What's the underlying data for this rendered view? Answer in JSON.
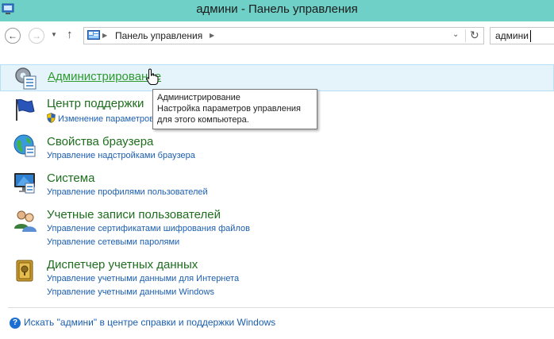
{
  "window": {
    "title": "админи - Панель управления"
  },
  "address": {
    "crumb": "Панель управления",
    "search_value": "админи"
  },
  "results": [
    {
      "heading": "Администрирование",
      "icon": "admin-tools-icon",
      "links": []
    },
    {
      "heading": "Центр поддержки",
      "icon": "flag-icon",
      "links": [
        "Изменение параметров"
      ]
    },
    {
      "heading": "Свойства браузера",
      "icon": "globe-icon",
      "links": [
        "Управление надстройками браузера"
      ]
    },
    {
      "heading": "Система",
      "icon": "computer-icon",
      "links": [
        "Управление профилями пользователей"
      ]
    },
    {
      "heading": "Учетные записи пользователей",
      "icon": "users-icon",
      "links": [
        "Управление сертификатами шифрования файлов",
        "Управление сетевыми паролями"
      ]
    },
    {
      "heading": "Диспетчер учетных данных",
      "icon": "vault-icon",
      "links": [
        "Управление учетными данными для Интернета",
        "Управление учетными данными Windows"
      ]
    }
  ],
  "tooltip": {
    "line1": "Администрирование",
    "line2": "Настройка параметров управления",
    "line3": "для этого компьютера."
  },
  "help": {
    "link": "Искать \"админи\" в центре справки и поддержки Windows"
  }
}
